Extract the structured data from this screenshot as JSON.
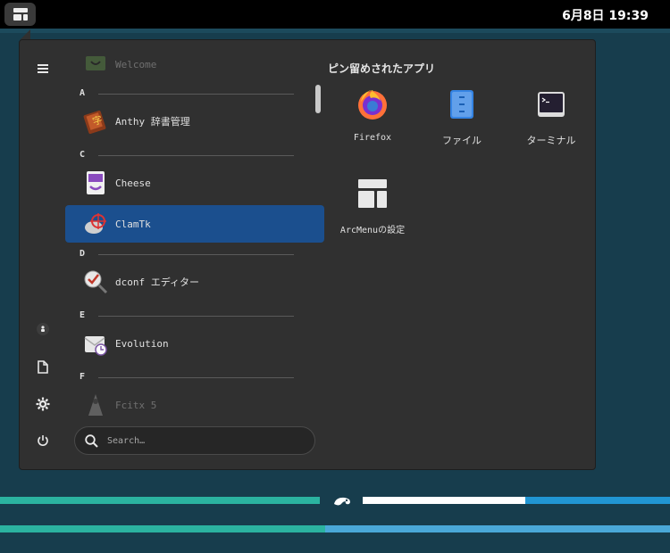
{
  "topbar": {
    "clock": "6月8日  19:39"
  },
  "list": {
    "items": [
      {
        "kind": "app",
        "label": "Welcome",
        "icon": "welcome-icon",
        "faded": true
      },
      {
        "kind": "letter",
        "label": "A"
      },
      {
        "kind": "app",
        "label": "Anthy 辞書管理",
        "icon": "anthy-dictionary-icon"
      },
      {
        "kind": "letter",
        "label": "C"
      },
      {
        "kind": "app",
        "label": "Cheese",
        "icon": "cheese-icon"
      },
      {
        "kind": "app",
        "label": "ClamTk",
        "icon": "clamtk-icon",
        "selected": true
      },
      {
        "kind": "letter",
        "label": "D"
      },
      {
        "kind": "app",
        "label": "dconf エディター",
        "icon": "dconf-editor-icon"
      },
      {
        "kind": "letter",
        "label": "E"
      },
      {
        "kind": "app",
        "label": "Evolution",
        "icon": "evolution-icon"
      },
      {
        "kind": "letter",
        "label": "F"
      },
      {
        "kind": "app",
        "label": "Fcitx 5",
        "icon": "fcitx-icon",
        "faded": true
      }
    ]
  },
  "search": {
    "placeholder": "Search…"
  },
  "pinned": {
    "title": "ピン留めされたアプリ",
    "apps": [
      {
        "label": "Firefox",
        "icon": "firefox-icon"
      },
      {
        "label": "ファイル",
        "icon": "files-icon"
      },
      {
        "label": "ターミナル",
        "icon": "terminal-icon"
      },
      {
        "label": "ArcMenuの設定",
        "icon": "arcmenu-settings-icon"
      }
    ]
  },
  "colors": {
    "selection": "#1b4f8e",
    "panel": "#303030",
    "desktop": "#173d4d",
    "accent_teal": "#2bb3a0",
    "accent_blue": "#4aa8d8"
  }
}
